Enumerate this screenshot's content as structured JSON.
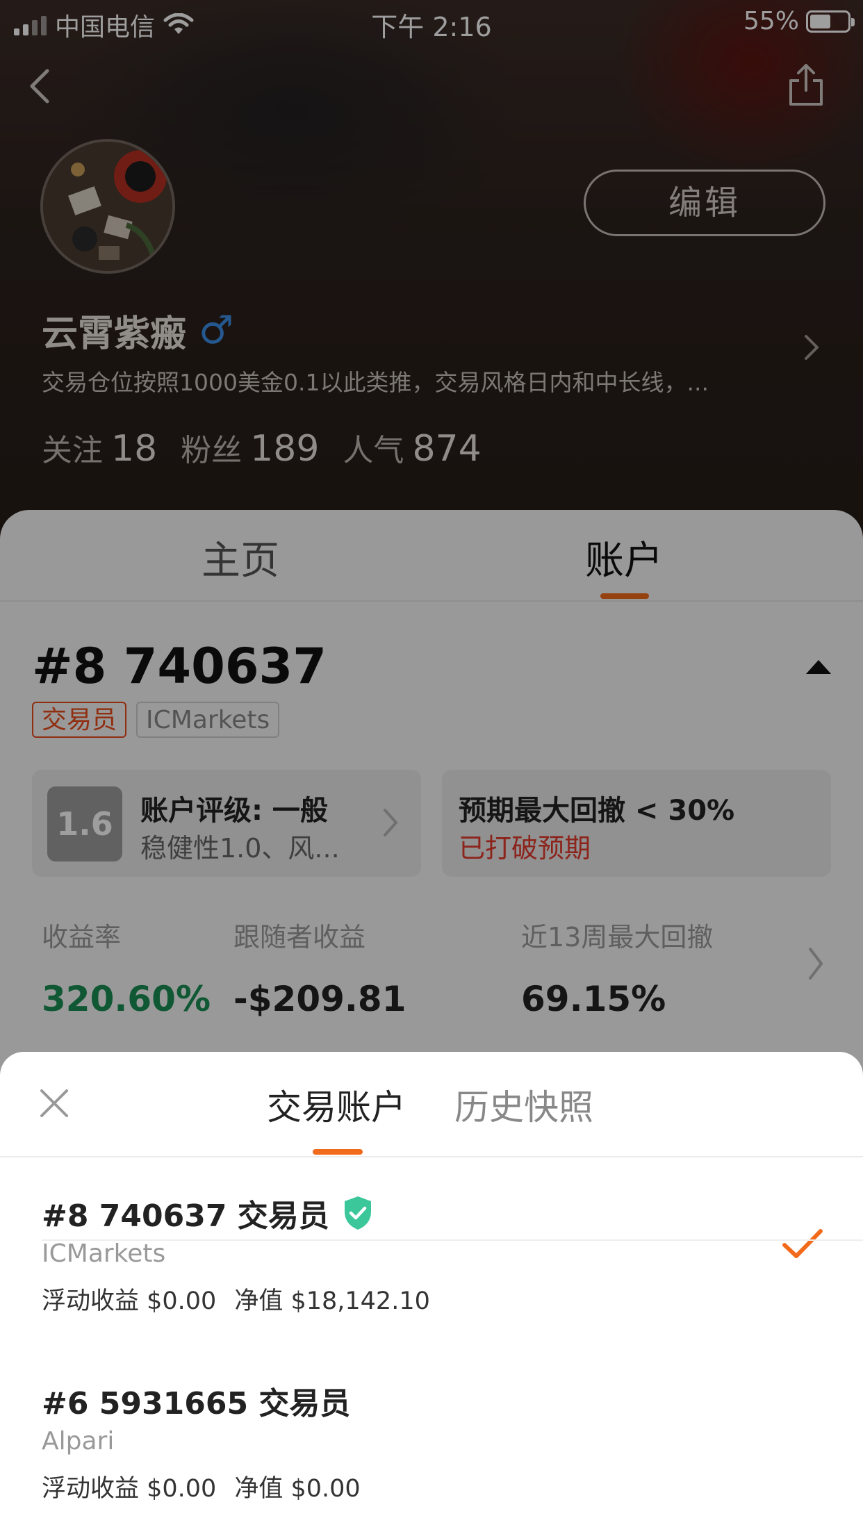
{
  "status_bar": {
    "carrier": "中国电信",
    "time": "下午 2:16",
    "battery": "55%"
  },
  "profile": {
    "name": "云霄紫瘢",
    "gender_symbol": "♂",
    "bio": "交易仓位按照1000美金0.1以此类推，交易风格日内和中长线，...",
    "edit_label": "编辑",
    "stats": [
      {
        "label": "关注",
        "value": "18"
      },
      {
        "label": "粉丝",
        "value": "189"
      },
      {
        "label": "人气",
        "value": "874"
      }
    ]
  },
  "tabs": [
    "主页",
    "账户"
  ],
  "active_tab": "账户",
  "account": {
    "number": "#8 740637",
    "role_badge": "交易员",
    "broker_badge": "ICMarkets",
    "rating_score": "1.6",
    "rating_title": "账户评级: 一般",
    "rating_desc": "稳健性1.0、风...",
    "drawdown_title": "预期最大回撤 < 30%",
    "drawdown_status": "已打破预期",
    "metrics": [
      {
        "label": "收益率",
        "value": "320.60%"
      },
      {
        "label": "跟随者收益",
        "value": "-$209.81"
      },
      {
        "label": "近13周最大回撤",
        "value": "69.15%"
      }
    ]
  },
  "sheet": {
    "tabs": [
      "交易账户",
      "历史快照"
    ],
    "active_tab": "交易账户",
    "accounts": [
      {
        "title": "#8 740637 交易员",
        "verified": true,
        "broker": "ICMarkets",
        "floating": "浮动收益 $0.00",
        "equity": "净值 $18,142.10",
        "selected": true
      },
      {
        "title": "#6 5931665 交易员",
        "verified": false,
        "broker": "Alpari",
        "floating": "浮动收益 $0.00",
        "equity": "净值 $0.00",
        "selected": false
      }
    ]
  },
  "colors": {
    "accent": "#f26a1b",
    "positive": "#1a8f55",
    "negative": "#e23a2e",
    "verified_shield": "#3cc79a"
  },
  "icons": [
    "back-icon",
    "share-icon",
    "chevron-right-icon",
    "triangle-up-icon",
    "close-icon",
    "shield-check-icon",
    "checkmark-icon"
  ]
}
